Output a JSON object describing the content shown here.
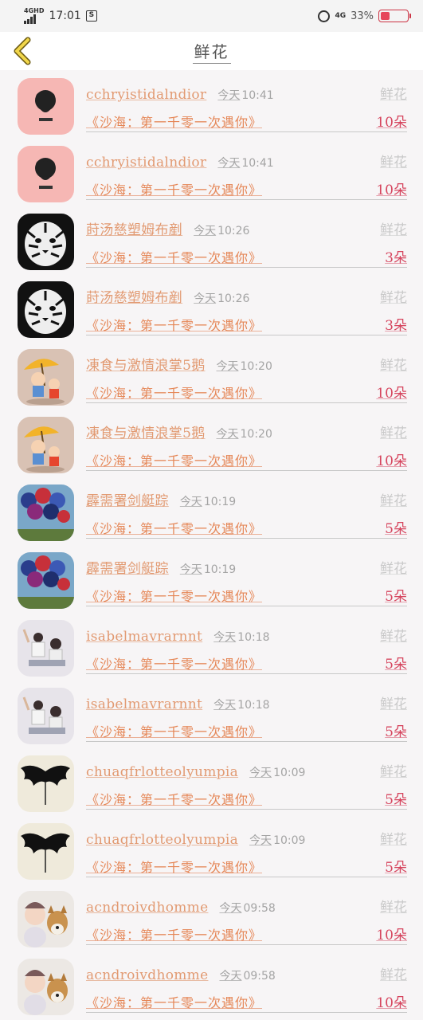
{
  "status": {
    "network": "4GHD",
    "time": "17:01",
    "net2": "4G",
    "battery": "33%",
    "battery_level": 0.33
  },
  "header": {
    "title": "鲜花"
  },
  "colors": {
    "name": "#e29a72",
    "gift": "#e58656",
    "count": "#d6455e",
    "muted": "#a4a4a4"
  },
  "items": [
    {
      "avatar": "chroi-pink-avatar",
      "name": "cchryistidalndior",
      "day": "今天",
      "time": "10:41",
      "category": "鲜花",
      "gift": "《沙海：第一千零一次遇你》",
      "count": "10",
      "unit": "朵"
    },
    {
      "avatar": "chroi-pink-avatar",
      "name": "cchryistidalndior",
      "day": "今天",
      "time": "10:41",
      "category": "鲜花",
      "gift": "《沙海：第一千零一次遇你》",
      "count": "10",
      "unit": "朵"
    },
    {
      "avatar": "tiger-avatar",
      "name": "莳汤慈塑姆布剷",
      "day": "今天",
      "time": "10:26",
      "category": "鲜花",
      "gift": "《沙海：第一千零一次遇你》",
      "count": "3",
      "unit": "朵"
    },
    {
      "avatar": "tiger-avatar",
      "name": "莳汤慈塑姆布剷",
      "day": "今天",
      "time": "10:26",
      "category": "鲜花",
      "gift": "《沙海：第一千零一次遇你》",
      "count": "3",
      "unit": "朵"
    },
    {
      "avatar": "cartoon-umbrella-avatar",
      "name": "凍食与激情浪掌5鹅",
      "day": "今天",
      "time": "10:20",
      "category": "鲜花",
      "gift": "《沙海：第一千零一次遇你》",
      "count": "10",
      "unit": "朵"
    },
    {
      "avatar": "cartoon-umbrella-avatar",
      "name": "凍食与激情浪掌5鹅",
      "day": "今天",
      "time": "10:20",
      "category": "鲜花",
      "gift": "《沙海：第一千零一次遇你》",
      "count": "10",
      "unit": "朵"
    },
    {
      "avatar": "balloons-avatar",
      "name": "霹需署剑艇踪",
      "day": "今天",
      "time": "10:19",
      "category": "鲜花",
      "gift": "《沙海：第一千零一次遇你》",
      "count": "5",
      "unit": "朵"
    },
    {
      "avatar": "balloons-avatar",
      "name": "霹需署剑艇踪",
      "day": "今天",
      "time": "10:19",
      "category": "鲜花",
      "gift": "《沙海：第一千零一次遇你》",
      "count": "5",
      "unit": "朵"
    },
    {
      "avatar": "couple-photo-avatar",
      "name": "isabelmavrarnnt",
      "day": "今天",
      "time": "10:18",
      "category": "鲜花",
      "gift": "《沙海：第一千零一次遇你》",
      "count": "5",
      "unit": "朵"
    },
    {
      "avatar": "couple-photo-avatar",
      "name": "isabelmavrarnnt",
      "day": "今天",
      "time": "10:18",
      "category": "鲜花",
      "gift": "《沙海：第一千零一次遇你》",
      "count": "5",
      "unit": "朵"
    },
    {
      "avatar": "black-wings-avatar",
      "name": "chuaqfrlotteolyumpia",
      "day": "今天",
      "time": "10:09",
      "category": "鲜花",
      "gift": "《沙海：第一千零一次遇你》",
      "count": "5",
      "unit": "朵"
    },
    {
      "avatar": "black-wings-avatar",
      "name": "chuaqfrlotteolyumpia",
      "day": "今天",
      "time": "10:09",
      "category": "鲜花",
      "gift": "《沙海：第一千零一次遇你》",
      "count": "5",
      "unit": "朵"
    },
    {
      "avatar": "child-dog-avatar",
      "name": "acndroivdhomme",
      "day": "今天",
      "time": "09:58",
      "category": "鲜花",
      "gift": "《沙海：第一千零一次遇你》",
      "count": "10",
      "unit": "朵"
    },
    {
      "avatar": "child-dog-avatar",
      "name": "acndroivdhomme",
      "day": "今天",
      "time": "09:58",
      "category": "鲜花",
      "gift": "《沙海：第一千零一次遇你》",
      "count": "10",
      "unit": "朵"
    }
  ]
}
